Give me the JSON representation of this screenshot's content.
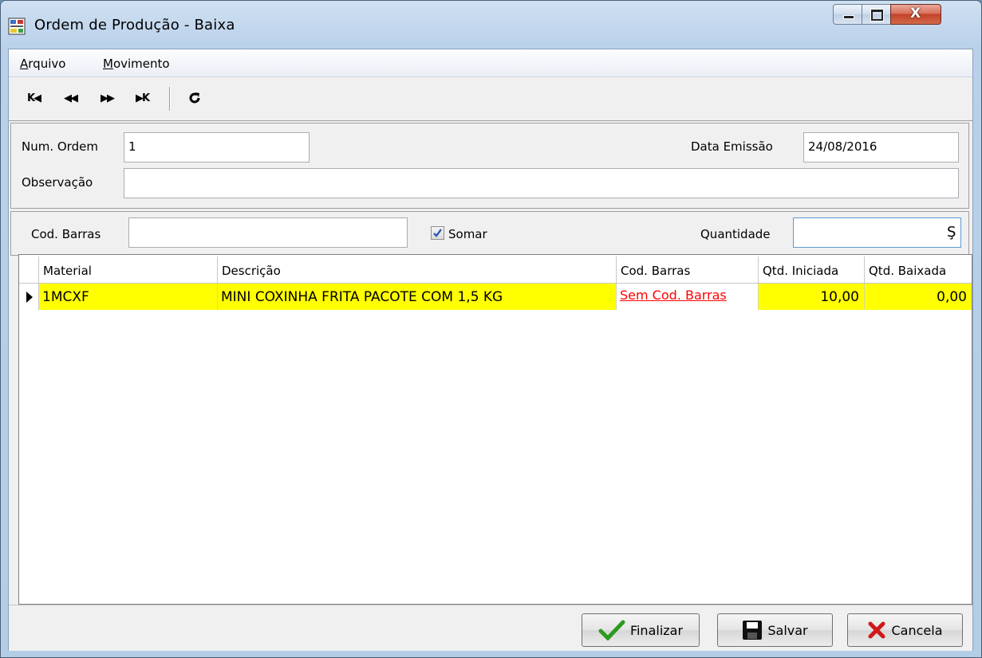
{
  "window": {
    "title": "Ordem de Produção - Baixa",
    "close_glyph": "X"
  },
  "menu": [
    {
      "label_ul": "A",
      "label_rest": "rquivo"
    },
    {
      "label_ul": "M",
      "label_rest": "ovimento"
    }
  ],
  "toolbar": {
    "icons": [
      "first-record-icon",
      "prev-record-icon",
      "next-record-icon",
      "last-record-icon",
      "refresh-icon"
    ],
    "glyphs": {
      "first": "K◀",
      "prev": "◀◀",
      "next": "▶▶",
      "last": "▶K"
    }
  },
  "form": {
    "num_ordem_label": "Num. Ordem",
    "num_ordem_value": "1",
    "data_emissao_label": "Data Emissão",
    "data_emissao_value": "24/08/2016",
    "observacao_label": "Observação",
    "observacao_value": ""
  },
  "scan": {
    "cod_barras_label": "Cod. Barras",
    "cod_barras_value": "",
    "somar_label": "Somar",
    "somar_checked": true,
    "quantidade_label": "Quantidade",
    "quantidade_value": ""
  },
  "grid": {
    "columns": [
      "Material",
      "Descrição",
      "Cod. Barras",
      "Qtd. Iniciada",
      "Qtd. Baixada"
    ],
    "rows": [
      {
        "material": "1MCXF",
        "descricao": "MINI COXINHA FRITA PACOTE COM 1,5 KG",
        "cod_barras": "Sem Cod. Barras",
        "qtd_iniciada": "10,00",
        "qtd_baixada": "0,00"
      }
    ],
    "row_highlight_color": "#ffff00",
    "link_color": "#ff0000"
  },
  "buttons": {
    "finalizar": "Finalizar",
    "salvar": "Salvar",
    "cancela": "Cancela"
  }
}
